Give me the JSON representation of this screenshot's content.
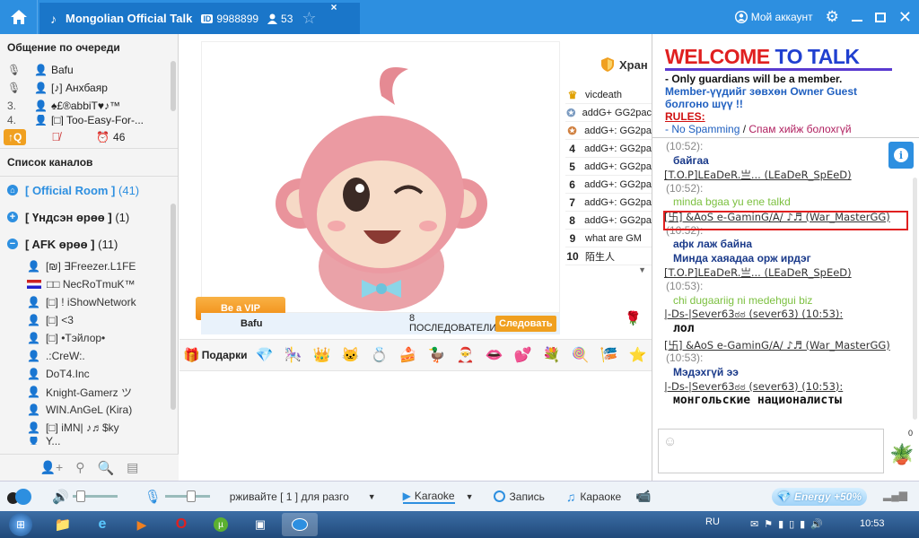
{
  "titlebar": {
    "room_title": "Mongolian Official Talk",
    "room_id": "9988899",
    "user_count": "53",
    "account_label": "Мой аккаунт"
  },
  "queue": {
    "title": "Общение по очереди",
    "items": [
      {
        "num": "",
        "name": "Bafu"
      },
      {
        "num": "",
        "name": "[♪] Анхбаяр"
      },
      {
        "num": "3.",
        "name": "♠£®abbiT♥♪™"
      },
      {
        "num": "4.",
        "name": "[□] Too-Easy-For-..."
      }
    ],
    "q_button": "↑Q",
    "queue_count": "46"
  },
  "channels": {
    "title": "Список каналов",
    "rooms": [
      {
        "label": "[ Official Room ]",
        "count": "(41)",
        "color": "#2d8fe0"
      },
      {
        "label": "[ Үндсэн өрөө ]",
        "count": "(1)",
        "color": "#222"
      },
      {
        "label": "[ AFK өрөө ]",
        "count": "(11)",
        "color": "#222"
      }
    ],
    "users": [
      "[₪] ∃Freezer.L1FE",
      "□□  NecRoTmuK™",
      "[□] ! iShowNetwork",
      "[□] <3",
      "[□] •Тэйлор•",
      ".:CreW:.",
      "DoT4.Inc",
      "Knight-Gamerz ツ",
      "WIN.AnGeL (Kira)",
      "[□] iMN| ♪♬$ky",
      "Y..."
    ]
  },
  "stage": {
    "vip_button": "Be a VIP",
    "performer": "Bafu",
    "followers_count": "8",
    "followers_label": "ПОСЛЕДОВАТЕЛИ",
    "follow_button": "Следовать",
    "guardians_title": "Хран",
    "ranking": [
      {
        "n": "",
        "name": "vicdeath"
      },
      {
        "n": "",
        "name": "addG+ GG2pac"
      },
      {
        "n": "",
        "name": "addG+: GG2pa"
      },
      {
        "n": "4",
        "name": "addG+: GG2pa"
      },
      {
        "n": "5",
        "name": "addG+: GG2pa"
      },
      {
        "n": "6",
        "name": "addG+: GG2pa"
      },
      {
        "n": "7",
        "name": "addG+: GG2pa"
      },
      {
        "n": "8",
        "name": "addG+: GG2pa"
      },
      {
        "n": "9",
        "name": "what are GM"
      },
      {
        "n": "10",
        "name": "陌生人"
      }
    ],
    "gifts_label": "Подарки"
  },
  "welcome": {
    "heading": "WELCOME TO TALK",
    "line1": "- Only guardians will be a member.",
    "line2": "Member-үүдийг зөвхөн Owner Guest",
    "line3": "болгоно шүү !!",
    "rules_label": "RULES:",
    "rule1a": "- No Spamming",
    "rule1sep": " / ",
    "rule1b": "Спам хийж болохгүй"
  },
  "chat": [
    {
      "type": "time",
      "text": "(10:52):"
    },
    {
      "type": "body",
      "text": "байгаа",
      "color": "#1a3a8a"
    },
    {
      "type": "name",
      "text": "[T.O.P]LEaDeR.亗... (LEaDeR_SpEeD)"
    },
    {
      "type": "time",
      "text": "(10:52):"
    },
    {
      "type": "body",
      "text": "minda bgaa yu ene talkd",
      "color": "#7cc040"
    },
    {
      "type": "name",
      "text": "[卐] &AoS e-GaminG/A/ ♪♬ (War_MasterGG)"
    },
    {
      "type": "time",
      "text": "(10:52):"
    },
    {
      "type": "body",
      "text": "афк лаж байна",
      "color": "#1a3a8a"
    },
    {
      "type": "body",
      "text": "Минда хаяадаа орж ирдэг",
      "color": "#1a3a8a"
    },
    {
      "type": "name",
      "text": "[T.O.P]LEaDeR.亗... (LEaDeR_SpEeD)"
    },
    {
      "type": "time",
      "text": "(10:53):"
    },
    {
      "type": "body",
      "text": "chi dugaariig ni medehgui biz",
      "color": "#7cc040"
    },
    {
      "type": "name",
      "text": "|-Ds-|Sever63ಠಠ (sever63) (10:53):"
    },
    {
      "type": "big",
      "text": "лол",
      "color": "#111"
    },
    {
      "type": "name",
      "text": "[卐] &AoS e-GaminG/A/ ♪♬ (War_MasterGG)"
    },
    {
      "type": "time",
      "text": "(10:53):"
    },
    {
      "type": "body",
      "text": "Мэдэхгүй ээ",
      "color": "#1a3a8a"
    },
    {
      "type": "name",
      "text": "|-Ds-|Sever63ಠಠ (sever63) (10:53):"
    },
    {
      "type": "big",
      "text": "монгольские  националисты",
      "color": "#111"
    }
  ],
  "input": {
    "flower_count": "0"
  },
  "bottombar": {
    "scroll_text": "рживайте [ 1 ] для разго",
    "karaoke_tab": "Karaoke",
    "record_label": "Запись",
    "karaoke_label": "Караоке",
    "energy_label": "Energy +50%"
  },
  "taskbar": {
    "lang": "RU",
    "clock": "10:53"
  }
}
